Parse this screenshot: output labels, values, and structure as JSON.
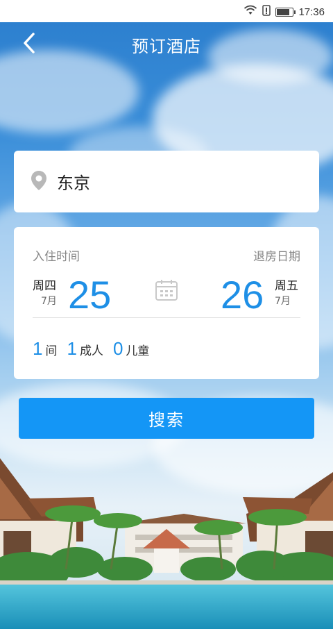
{
  "status_bar": {
    "time": "17:36",
    "battery_level": 0.85,
    "icons": [
      "wifi-icon",
      "alert-icon",
      "battery-icon"
    ]
  },
  "header": {
    "title": "预订酒店",
    "back_icon": "chevron-left-icon"
  },
  "destination": {
    "icon": "location-pin-icon",
    "city": "东京"
  },
  "dates": {
    "checkin_label": "入住时间",
    "checkout_label": "退房日期",
    "checkin": {
      "weekday": "周四",
      "month": "7月",
      "day": "25"
    },
    "checkout": {
      "weekday": "周五",
      "month": "7月",
      "day": "26"
    },
    "calendar_icon": "calendar-icon"
  },
  "occupancy": {
    "rooms": {
      "count": "1",
      "unit": "间"
    },
    "adults": {
      "count": "1",
      "unit": "成人"
    },
    "children": {
      "count": "0",
      "unit": "儿童"
    }
  },
  "search_button": {
    "label": "搜索"
  },
  "colors": {
    "accent": "#1e8fe6",
    "button": "#1496f6",
    "sky": "#2d80cf",
    "pool": "#2aa6c9"
  }
}
